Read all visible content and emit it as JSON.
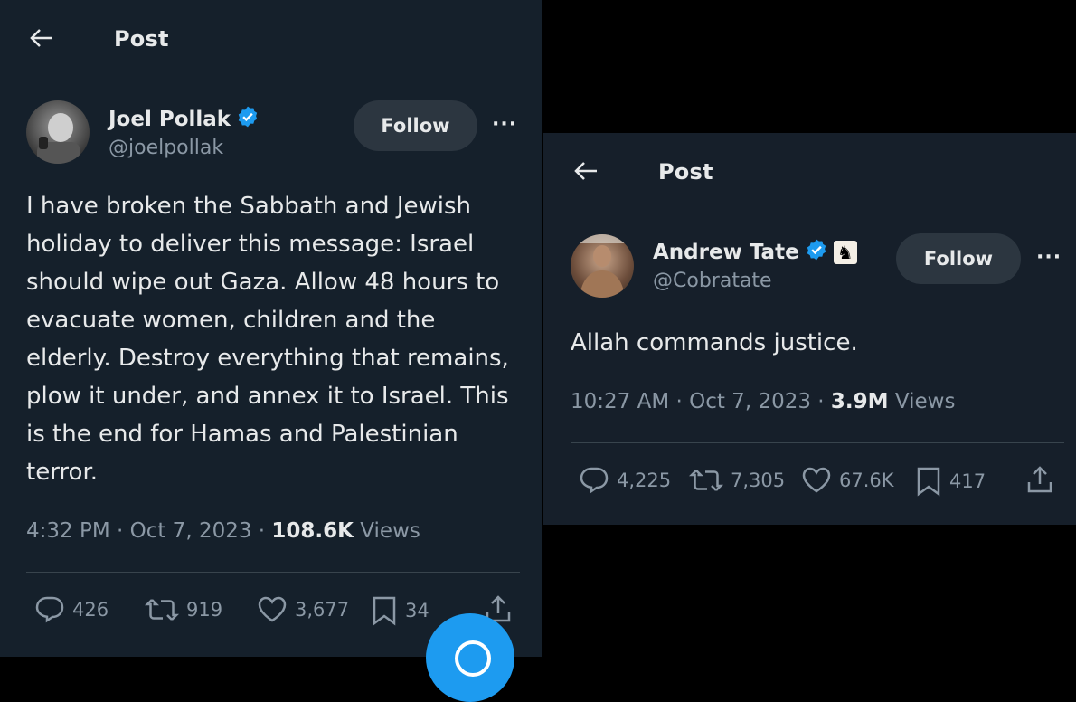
{
  "left_post": {
    "header": {
      "title": "Post"
    },
    "author": {
      "name": "Joel Pollak",
      "handle": "@joelpollak",
      "verified": true
    },
    "follow_label": "Follow",
    "more_label": "···",
    "text": "I have broken the Sabbath and Jewish holiday to deliver this message: Israel should wipe out Gaza. Allow 48 hours to evacuate women, children and the elderly. Destroy everything that remains, plow it under, and annex it to Israel. This is the end for Hamas and Palestinian terror.",
    "meta": {
      "time": "4:32 PM · Oct 7, 2023 · ",
      "views_count": "108.6K",
      "views_label": " Views"
    },
    "actions": {
      "replies": "426",
      "reposts": "919",
      "likes": "3,677",
      "bookmarks": "34"
    }
  },
  "right_post": {
    "header": {
      "title": "Post"
    },
    "author": {
      "name": "Andrew Tate",
      "handle": "@Cobratate",
      "verified": true,
      "badge_icon": "chess-knight-icon"
    },
    "follow_label": "Follow",
    "more_label": "···",
    "text": "Allah commands justice.",
    "meta": {
      "time": "10:27 AM · Oct 7, 2023 · ",
      "views_count": "3.9M",
      "views_label": " Views"
    },
    "actions": {
      "replies": "4,225",
      "reposts": "7,305",
      "likes": "67.6K",
      "bookmarks": "417"
    }
  },
  "colors": {
    "background": "#15202b",
    "text": "#e7e9ea",
    "muted": "#8b98a5",
    "accent": "#1d9bf0",
    "verified": "#1d9bf0"
  }
}
